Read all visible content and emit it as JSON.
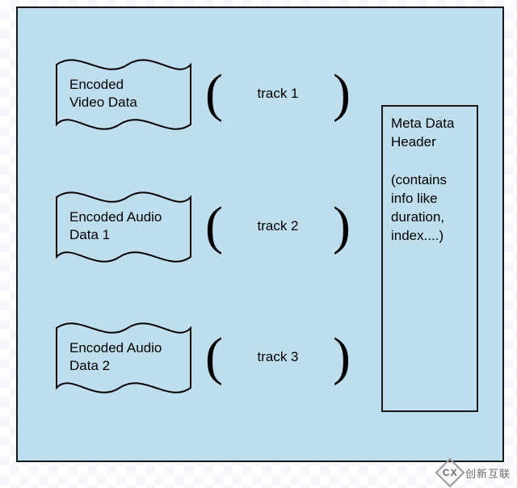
{
  "rows": [
    {
      "data_label": "Encoded\nVideo Data",
      "track_label": "track 1"
    },
    {
      "data_label": "Encoded Audio Data 1",
      "track_label": "track 2"
    },
    {
      "data_label": "Encoded Audio Data 2",
      "track_label": "track 3"
    }
  ],
  "meta": {
    "title": "Meta Data Header",
    "body": "(contains info like duration, index....)"
  },
  "watermark": "创新互联"
}
